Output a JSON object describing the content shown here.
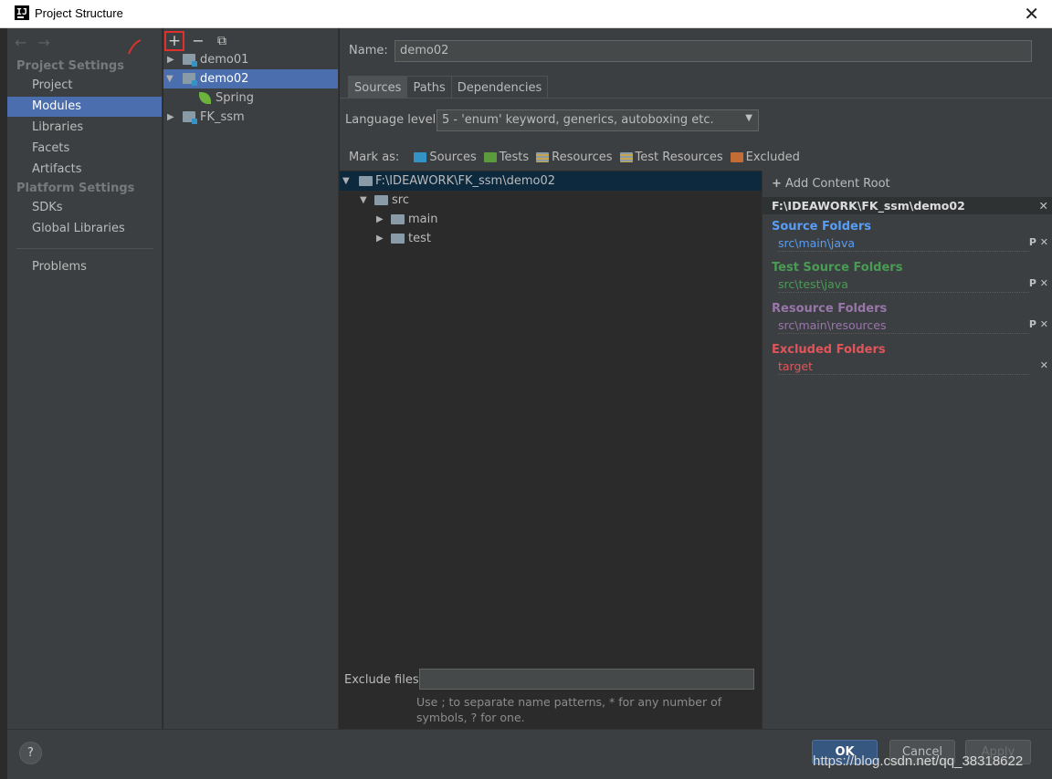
{
  "window": {
    "title": "Project Structure",
    "logo_text": "IJ",
    "close": "✕"
  },
  "sidebar": {
    "project_settings_title": "Project Settings",
    "project_items": [
      {
        "label": "Project"
      },
      {
        "label": "Modules",
        "selected": true
      },
      {
        "label": "Libraries"
      },
      {
        "label": "Facets"
      },
      {
        "label": "Artifacts"
      }
    ],
    "platform_settings_title": "Platform Settings",
    "platform_items": [
      {
        "label": "SDKs"
      },
      {
        "label": "Global Libraries"
      }
    ],
    "problems": "Problems"
  },
  "module_tree": {
    "toolbar": {
      "add": "+",
      "remove": "−",
      "copy": "⧉"
    },
    "items": [
      {
        "label": "demo01",
        "expanded": false
      },
      {
        "label": "demo02",
        "expanded": true,
        "selected": true
      },
      {
        "label": "Spring",
        "child": true
      },
      {
        "label": "FK_ssm",
        "expanded": false
      }
    ]
  },
  "main": {
    "name_label": "Name:",
    "name_value": "demo02",
    "tabs": [
      {
        "label": "Sources",
        "active": true
      },
      {
        "label": "Paths"
      },
      {
        "label": "Dependencies"
      }
    ],
    "language_level_label": "Language level:",
    "language_level_value": "5 - 'enum' keyword, generics, autoboxing etc.",
    "mark_as_label": "Mark as:",
    "mark_as": [
      {
        "label": "Sources",
        "color": "#3592c4"
      },
      {
        "label": "Tests",
        "color": "#5b9b3e"
      },
      {
        "label": "Resources",
        "color": "#8a9ba8"
      },
      {
        "label": "Test Resources",
        "color": "#8a9ba8"
      },
      {
        "label": "Excluded",
        "color": "#c46c35"
      }
    ],
    "content_tree": [
      {
        "label": "F:\\IDEAWORK\\FK_ssm\\demo02",
        "selected": true
      },
      {
        "label": "src"
      },
      {
        "label": "main"
      },
      {
        "label": "test"
      }
    ],
    "exclude_label": "Exclude files:",
    "exclude_value": "",
    "exclude_hint": "Use ; to separate name patterns, * for any number of symbols, ? for one."
  },
  "roots": {
    "add_content_root": "Add Content Root",
    "root_path": "F:\\IDEAWORK\\FK_ssm\\demo02",
    "groups": [
      {
        "title": "Source Folders",
        "path": "src\\main\\java",
        "color": "#589df6"
      },
      {
        "title": "Test Source Folders",
        "path": "src\\test\\java",
        "color": "#499c54"
      },
      {
        "title": "Resource Folders",
        "path": "src\\main\\resources",
        "color": "#9876aa"
      },
      {
        "title": "Excluded Folders",
        "path": "target",
        "color": "#e0555a"
      }
    ]
  },
  "buttons": {
    "help": "?",
    "ok": "OK",
    "cancel": "Cancel",
    "apply": "Apply"
  },
  "watermark": "https://blog.csdn.net/qq_38318622"
}
